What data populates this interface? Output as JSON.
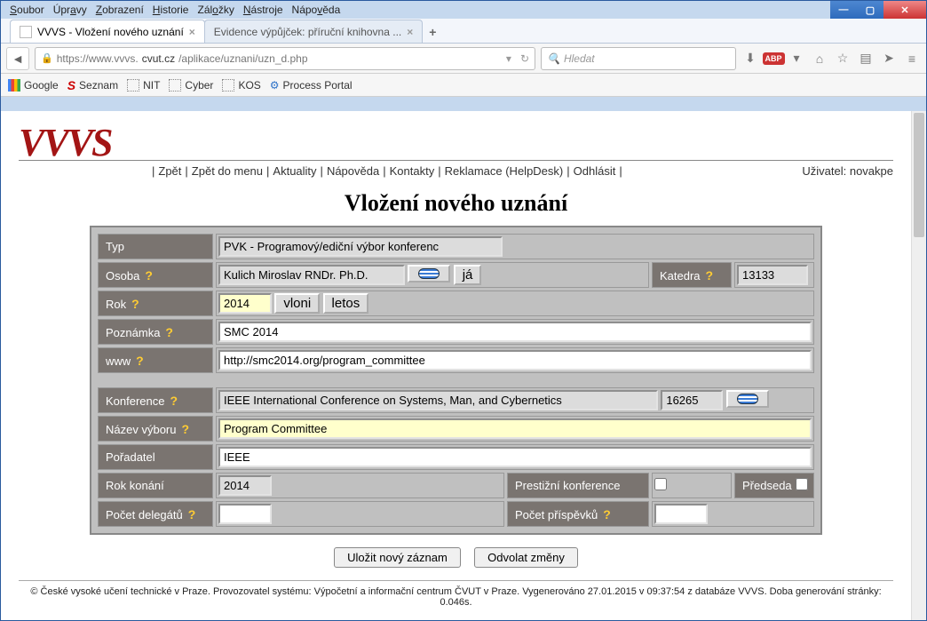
{
  "window": {
    "menus": [
      "Soubor",
      "Úpravy",
      "Zobrazení",
      "Historie",
      "Záložky",
      "Nástroje",
      "Nápověda"
    ]
  },
  "tabs": {
    "active": "VVVS - Vložení nového uznání",
    "inactive": "Evidence výpůjček: příruční knihovna ...",
    "add": "+"
  },
  "url": {
    "prefix": "https://www.vvvs.",
    "host": "cvut.cz",
    "path": "/aplikace/uznani/uzn_d.php"
  },
  "search": {
    "placeholder": "Hledat"
  },
  "bookmarks": {
    "google": "Google",
    "seznam": "Seznam",
    "nit": "NIT",
    "cyber": "Cyber",
    "kos": "KOS",
    "portal": "Process Portal"
  },
  "page": {
    "logo": "VVVS",
    "links": {
      "zpet": "Zpět",
      "zpet_menu": "Zpět do menu",
      "aktuality": "Aktuality",
      "napoveda": "Nápověda",
      "kontakty": "Kontakty",
      "reklamace": "Reklamace (HelpDesk)",
      "odhlasit": "Odhlásit"
    },
    "user_label": "Uživatel: ",
    "user": "novakpe",
    "title": "Vložení nového uznání"
  },
  "labels": {
    "typ": "Typ",
    "osoba": "Osoba",
    "katedra": "Katedra",
    "rok": "Rok",
    "poznamka": "Poznámka",
    "www": "www",
    "konference": "Konference",
    "nazev_vyboru": "Název výboru",
    "poradatel": "Pořadatel",
    "rok_konani": "Rok konání",
    "prestizni": "Prestižní konference",
    "predseda": "Předseda",
    "pocet_delegatu": "Počet delegátů",
    "pocet_prispevku": "Počet příspěvků"
  },
  "values": {
    "typ": "PVK - Programový/ediční výbor konferenc",
    "osoba": "Kulich Miroslav RNDr. Ph.D.",
    "katedra": "13133",
    "rok": "2014",
    "poznamka": "SMC 2014",
    "www": "http://smc2014.org/program_committee",
    "konference": "IEEE International Conference on Systems, Man, and Cybernetics",
    "konference_id": "16265",
    "nazev_vyboru": "Program Committee",
    "poradatel": "IEEE",
    "rok_konani": "2014",
    "pocet_delegatu": "",
    "pocet_prispevku": ""
  },
  "buttons": {
    "ja": "já",
    "vloni": "vloni",
    "letos": "letos",
    "ulozit": "Uložit nový záznam",
    "odvolat": "Odvolat změny"
  },
  "help": "?",
  "footer": "© České vysoké učení technické v Praze. Provozovatel systému: Výpočetní a informační centrum ČVUT v Praze. Vygenerováno 27.01.2015 v 09:37:54 z databáze VVVS. Doba generování stránky: 0.046s."
}
